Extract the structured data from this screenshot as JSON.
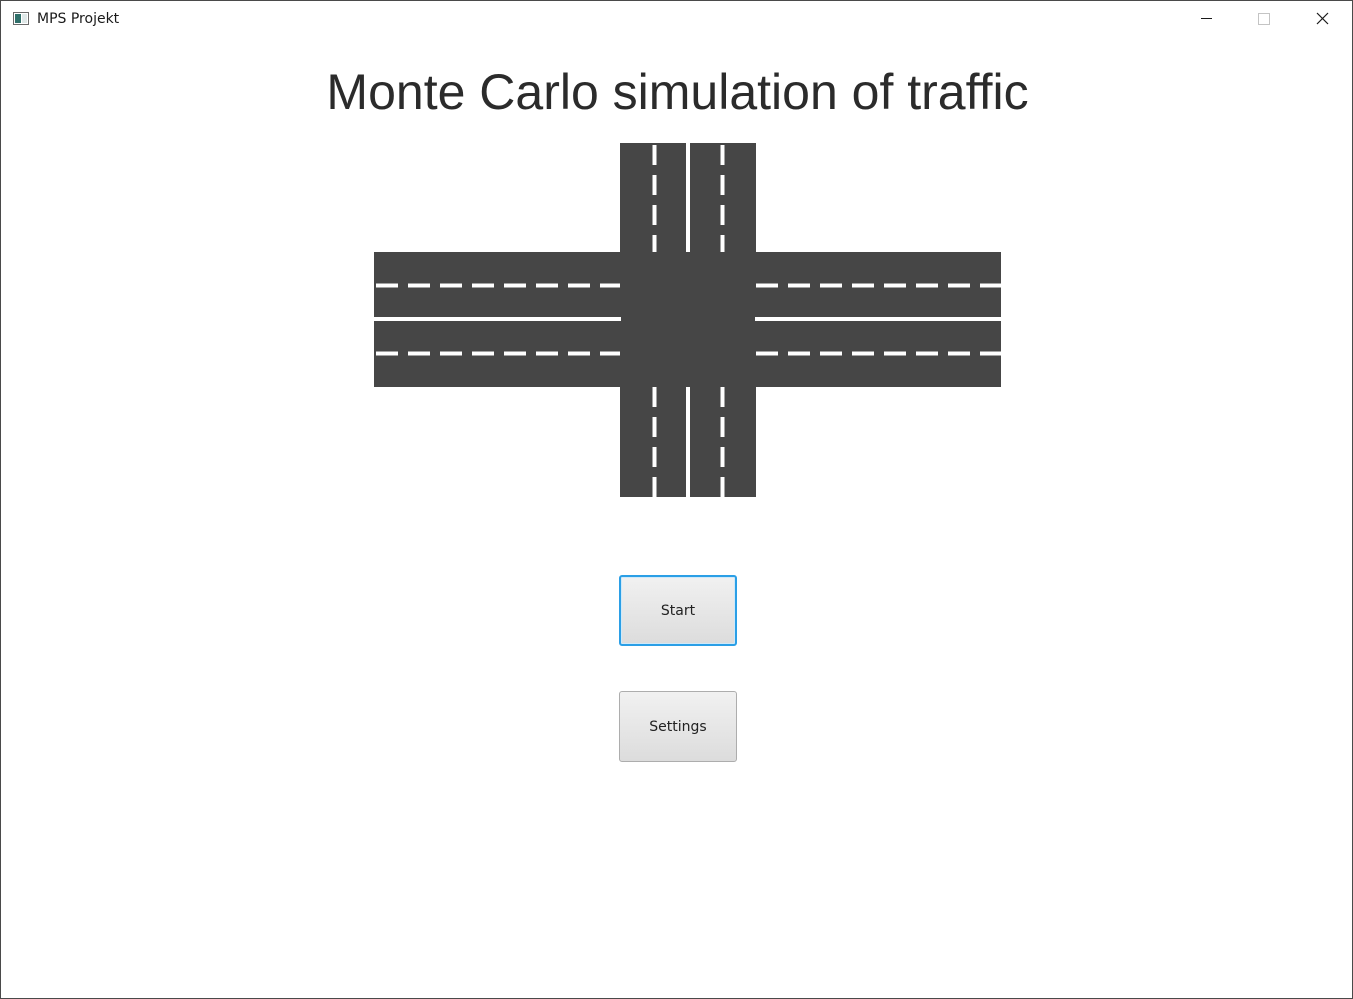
{
  "window": {
    "title": "MPS Projekt",
    "icon": "java-app-icon",
    "controls": {
      "minimize": "minimize-icon",
      "maximize": "maximize-icon",
      "close": "close-icon"
    }
  },
  "main": {
    "heading": "Monte Carlo simulation of traffic",
    "illustration": "four-way-intersection",
    "buttons": {
      "start_label": "Start",
      "settings_label": "Settings"
    }
  },
  "colors": {
    "road": "#464646",
    "lane_marking": "#ffffff",
    "focus_border": "#2b9fe6"
  }
}
